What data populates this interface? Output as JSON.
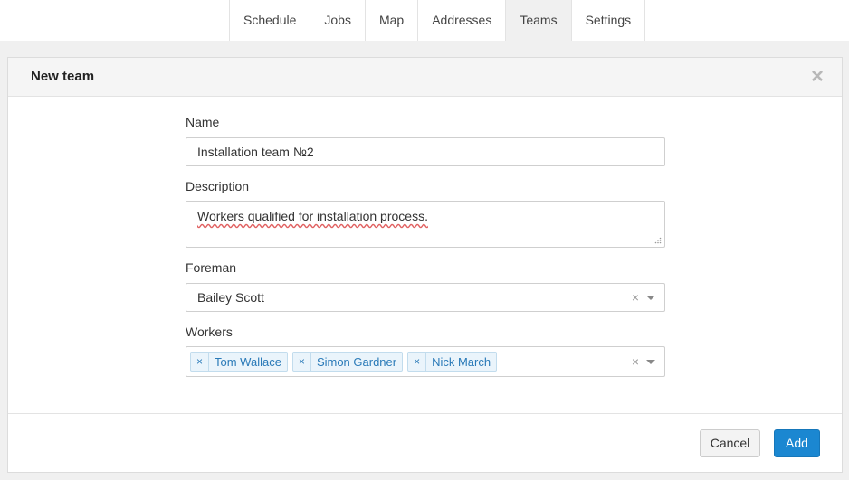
{
  "nav": {
    "tabs": [
      {
        "label": "Schedule"
      },
      {
        "label": "Jobs"
      },
      {
        "label": "Map"
      },
      {
        "label": "Addresses"
      },
      {
        "label": "Teams",
        "active": true
      },
      {
        "label": "Settings"
      }
    ]
  },
  "modal": {
    "title": "New team",
    "close_glyph": "×",
    "name": {
      "label": "Name",
      "value": "Installation team №2"
    },
    "description": {
      "label": "Description",
      "value": "Workers qualified for installation process."
    },
    "foreman": {
      "label": "Foreman",
      "value": "Bailey Scott",
      "clear_glyph": "×"
    },
    "workers": {
      "label": "Workers",
      "clear_glyph": "×",
      "tag_remove_glyph": "×",
      "items": [
        "Tom Wallace",
        "Simon Gardner",
        "Nick March"
      ]
    },
    "buttons": {
      "cancel": "Cancel",
      "add": "Add"
    }
  },
  "colors": {
    "accent": "#1b87d1",
    "tag_bg": "#eaf4fb",
    "tag_text": "#2a7ab8"
  },
  "icons": {
    "close": "close-icon",
    "clear": "clear-icon",
    "dropdown": "chevron-down-icon",
    "tag_remove": "remove-tag-icon"
  }
}
